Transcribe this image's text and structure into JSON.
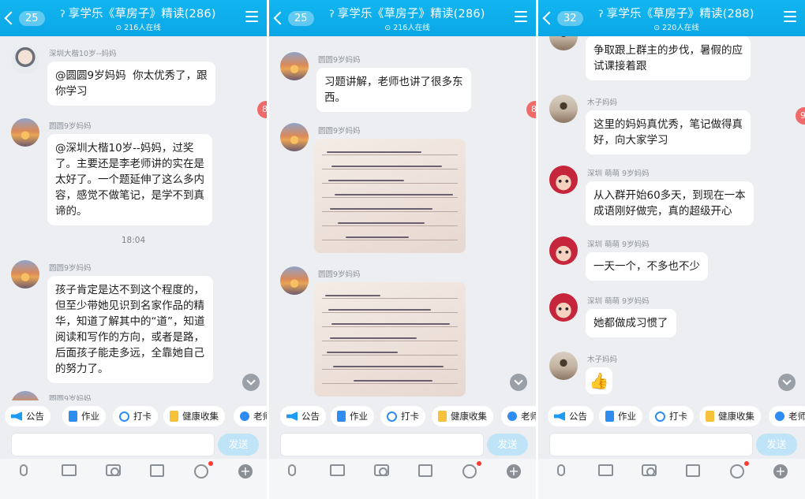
{
  "panels": [
    {
      "back_count": "25",
      "title": "享学乐《草房子》精读(286)",
      "online": "216人在线",
      "side_badge": "8",
      "time": "18:04",
      "messages": [
        {
          "name": "深圳大楷10岁--妈妈",
          "text": "@圆圆9岁妈妈  你太优秀了，跟\n你学习"
        },
        {
          "name": "圆圆9岁妈妈",
          "text": "@深圳大楷10岁--妈妈，过奖\n了。主要还是李老师讲的实在是\n太好了。一个题延伸了这么多内\n容，感觉不做笔记，是学不到真\n谛的。"
        },
        {
          "name": "圆圆9岁妈妈",
          "text": "孩子肯定是达不到这个程度的，\n但至少带她见识到名家作品的精\n华，知道了解其中的“道”，知道\n阅读和写作的方向，或者是路，\n后面孩子能走多远，全靠她自己\n的努力了。"
        },
        {
          "name": "圆圆9岁妈妈",
          "text": ""
        }
      ]
    },
    {
      "back_count": "25",
      "title": "享学乐《草房子》精读(286)",
      "online": "216人在线",
      "side_badge": "8",
      "messages": [
        {
          "name": "圆圆9岁妈妈",
          "text": "习题讲解，老师也讲了很多东\n西。"
        },
        {
          "name": "圆圆9岁妈妈",
          "text": ""
        },
        {
          "name": "圆圆9岁妈妈",
          "text": ""
        }
      ]
    },
    {
      "back_count": "32",
      "title": "享学乐《草房子》精读(288)",
      "online": "220人在线",
      "side_badge": "9",
      "messages": [
        {
          "name": "",
          "text": "争取跟上群主的步伐，暑假的应\n试课接着跟"
        },
        {
          "name": "木子妈妈",
          "text": "这里的妈妈真优秀，笔记做得真\n好，向大家学习"
        },
        {
          "name": "深圳 萌萌 9岁妈妈",
          "text": "从入群开始60多天，到现在一本\n成语刚好做完，真的超级开心"
        },
        {
          "name": "深圳 萌萌 9岁妈妈",
          "text": "一天一个，不多也不少"
        },
        {
          "name": "深圳 萌萌 9岁妈妈",
          "text": "她都做成习惯了"
        },
        {
          "name": "木子妈妈",
          "text": "👍"
        }
      ]
    }
  ],
  "toolbar": {
    "items": [
      "公告",
      "作业",
      "打卡",
      "健康收集",
      "老师"
    ]
  },
  "input": {
    "send_label": "发送"
  },
  "icons": {
    "back": "chevron-left-icon",
    "menu": "hamburger-menu-icon",
    "voice": "microphone-icon",
    "image": "image-icon",
    "camera": "camera-icon",
    "redpacket": "red-envelope-icon",
    "emoji": "emoji-icon",
    "more": "plus-icon"
  },
  "colors": {
    "header": "#0aa6e6",
    "accent": "#2f8cf0",
    "badge": "#f06a6a",
    "background": "#eceef2"
  }
}
